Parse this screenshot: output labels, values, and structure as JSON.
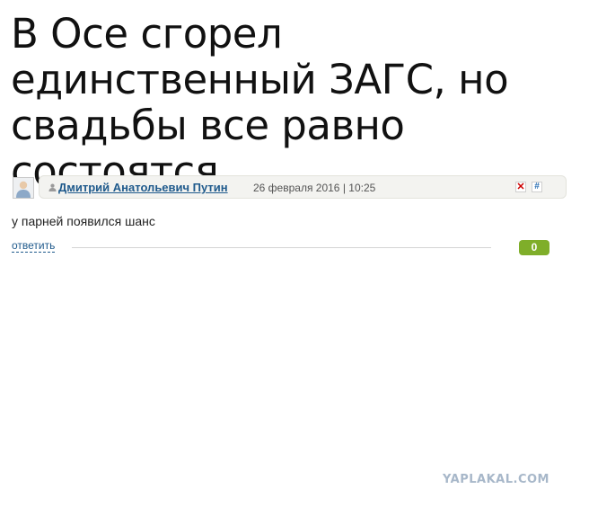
{
  "article": {
    "title": "В Осе сгорел единственный ЗАГС, но свадьбы все равно состоятся"
  },
  "comment": {
    "author": "Дмитрий Анатольевич Путин",
    "date": "26 февраля 2016 | 10:25",
    "text": "у парней появился шанс",
    "reply_label": "ответить",
    "rating": "0",
    "icons": [
      "avatar-placeholder-icon",
      "user-icon",
      "delete-icon",
      "permalink-icon"
    ],
    "delete_glyph": "✕",
    "link_glyph": "#"
  },
  "watermark": "YAPLAKAL.COM",
  "colors": {
    "author_link": "#1f5a8c",
    "rating_badge": "#7fae2a",
    "watermark": "#a7b7c9"
  }
}
